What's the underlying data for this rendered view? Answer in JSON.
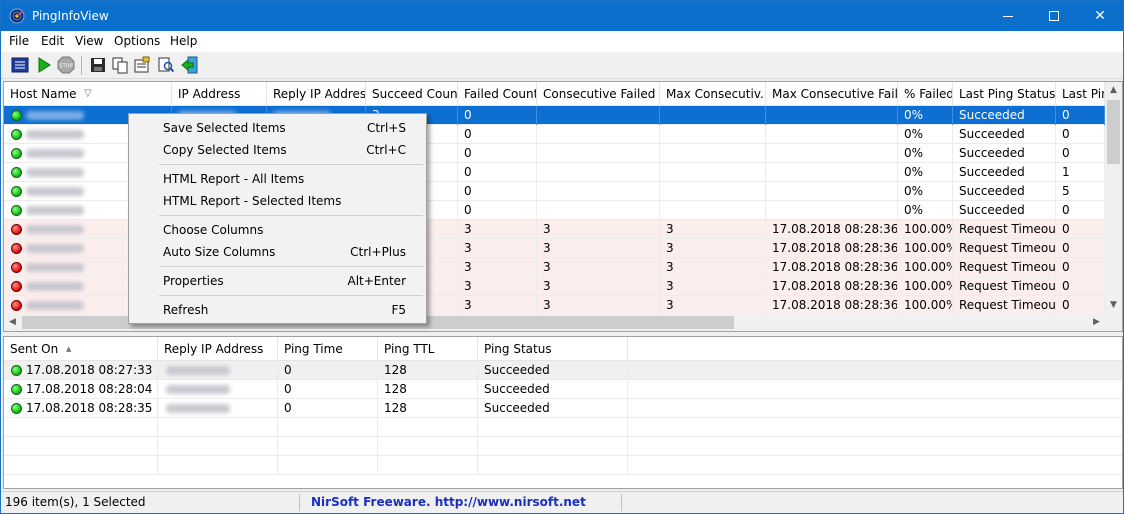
{
  "window": {
    "title": "PingInfoView",
    "icon": "radar-app-icon"
  },
  "menu": [
    "File",
    "Edit",
    "View",
    "Options",
    "Help"
  ],
  "toolbar": {
    "buttons": [
      "options-icon",
      "start-ping-icon",
      "stop-ping-icon",
      "save-icon",
      "copy-icon",
      "properties-icon",
      "find-icon",
      "exit-icon"
    ],
    "stop_label": "STOP"
  },
  "top_table": {
    "columns": [
      "Host Name",
      "IP Address",
      "Reply IP Address",
      "Succeed Count",
      "Failed Count",
      "Consecutive Failed ...",
      "Max Consecutiv...",
      "Max Consecutive Fail...",
      "% Failed",
      "Last Ping Status",
      "Last Pin..."
    ],
    "sort_indicator": "▽",
    "rows": [
      {
        "status": "success",
        "selected": true,
        "failed": false,
        "succeed": "3",
        "failed_count": "0",
        "consecutive": "",
        "max_consecutive": "",
        "max_fail_time": "",
        "pct_failed": "0%",
        "last_status": "Succeeded",
        "last_ping": "0"
      },
      {
        "status": "success",
        "selected": false,
        "failed": false,
        "succeed": "",
        "failed_count": "0",
        "consecutive": "",
        "max_consecutive": "",
        "max_fail_time": "",
        "pct_failed": "0%",
        "last_status": "Succeeded",
        "last_ping": "0"
      },
      {
        "status": "success",
        "selected": false,
        "failed": false,
        "succeed": "",
        "failed_count": "0",
        "consecutive": "",
        "max_consecutive": "",
        "max_fail_time": "",
        "pct_failed": "0%",
        "last_status": "Succeeded",
        "last_ping": "0"
      },
      {
        "status": "success",
        "selected": false,
        "failed": false,
        "succeed": "",
        "failed_count": "0",
        "consecutive": "",
        "max_consecutive": "",
        "max_fail_time": "",
        "pct_failed": "0%",
        "last_status": "Succeeded",
        "last_ping": "1"
      },
      {
        "status": "success",
        "selected": false,
        "failed": false,
        "succeed": "",
        "failed_count": "0",
        "consecutive": "",
        "max_consecutive": "",
        "max_fail_time": "",
        "pct_failed": "0%",
        "last_status": "Succeeded",
        "last_ping": "5"
      },
      {
        "status": "success",
        "selected": false,
        "failed": false,
        "succeed": "",
        "failed_count": "0",
        "consecutive": "",
        "max_consecutive": "",
        "max_fail_time": "",
        "pct_failed": "0%",
        "last_status": "Succeeded",
        "last_ping": "0"
      },
      {
        "status": "failed",
        "selected": false,
        "failed": true,
        "succeed": "",
        "failed_count": "3",
        "consecutive": "3",
        "max_consecutive": "3",
        "max_fail_time": "17.08.2018 08:28:36",
        "pct_failed": "100.00%",
        "last_status": "Request Timeout",
        "last_ping": "0"
      },
      {
        "status": "failed",
        "selected": false,
        "failed": true,
        "succeed": "",
        "failed_count": "3",
        "consecutive": "3",
        "max_consecutive": "3",
        "max_fail_time": "17.08.2018 08:28:36",
        "pct_failed": "100.00%",
        "last_status": "Request Timeout",
        "last_ping": "0"
      },
      {
        "status": "failed",
        "selected": false,
        "failed": true,
        "succeed": "",
        "failed_count": "3",
        "consecutive": "3",
        "max_consecutive": "3",
        "max_fail_time": "17.08.2018 08:28:36",
        "pct_failed": "100.00%",
        "last_status": "Request Timeout",
        "last_ping": "0"
      },
      {
        "status": "failed",
        "selected": false,
        "failed": true,
        "succeed": "",
        "failed_count": "3",
        "consecutive": "3",
        "max_consecutive": "3",
        "max_fail_time": "17.08.2018 08:28:36",
        "pct_failed": "100.00%",
        "last_status": "Request Timeout",
        "last_ping": "0"
      },
      {
        "status": "failed",
        "selected": false,
        "failed": true,
        "succeed": "",
        "failed_count": "3",
        "consecutive": "3",
        "max_consecutive": "3",
        "max_fail_time": "17.08.2018 08:28:36",
        "pct_failed": "100.00%",
        "last_status": "Request Timeout",
        "last_ping": "0"
      }
    ]
  },
  "context_menu": {
    "items": [
      {
        "label": "Save Selected Items",
        "shortcut": "Ctrl+S"
      },
      {
        "label": "Copy Selected Items",
        "shortcut": "Ctrl+C"
      },
      {
        "separator": true
      },
      {
        "label": "HTML Report - All Items",
        "shortcut": ""
      },
      {
        "label": "HTML Report - Selected Items",
        "shortcut": ""
      },
      {
        "separator": true
      },
      {
        "label": "Choose Columns",
        "shortcut": ""
      },
      {
        "label": "Auto Size Columns",
        "shortcut": "Ctrl+Plus"
      },
      {
        "separator": true
      },
      {
        "label": "Properties",
        "shortcut": "Alt+Enter"
      },
      {
        "separator": true
      },
      {
        "label": "Refresh",
        "shortcut": "F5"
      }
    ]
  },
  "bottom_table": {
    "columns": [
      "Sent On",
      "Reply IP Address",
      "Ping Time",
      "Ping TTL",
      "Ping Status"
    ],
    "sort_indicator": "▲",
    "rows": [
      {
        "sent_on": "17.08.2018 08:27:33",
        "ping_time": "0",
        "ttl": "128",
        "status": "Succeeded",
        "selected": true
      },
      {
        "sent_on": "17.08.2018 08:28:04",
        "ping_time": "0",
        "ttl": "128",
        "status": "Succeeded",
        "selected": false
      },
      {
        "sent_on": "17.08.2018 08:28:35",
        "ping_time": "0",
        "ttl": "128",
        "status": "Succeeded",
        "selected": false
      }
    ]
  },
  "statusbar": {
    "count": "196 item(s), 1 Selected",
    "freeware": "NirSoft Freeware.  http://www.nirsoft.net"
  },
  "colors": {
    "titlebar": "#0b6fcc",
    "selection": "#0d6fd1",
    "failed_row": "#fdeeee",
    "link": "#1a2fbf"
  }
}
